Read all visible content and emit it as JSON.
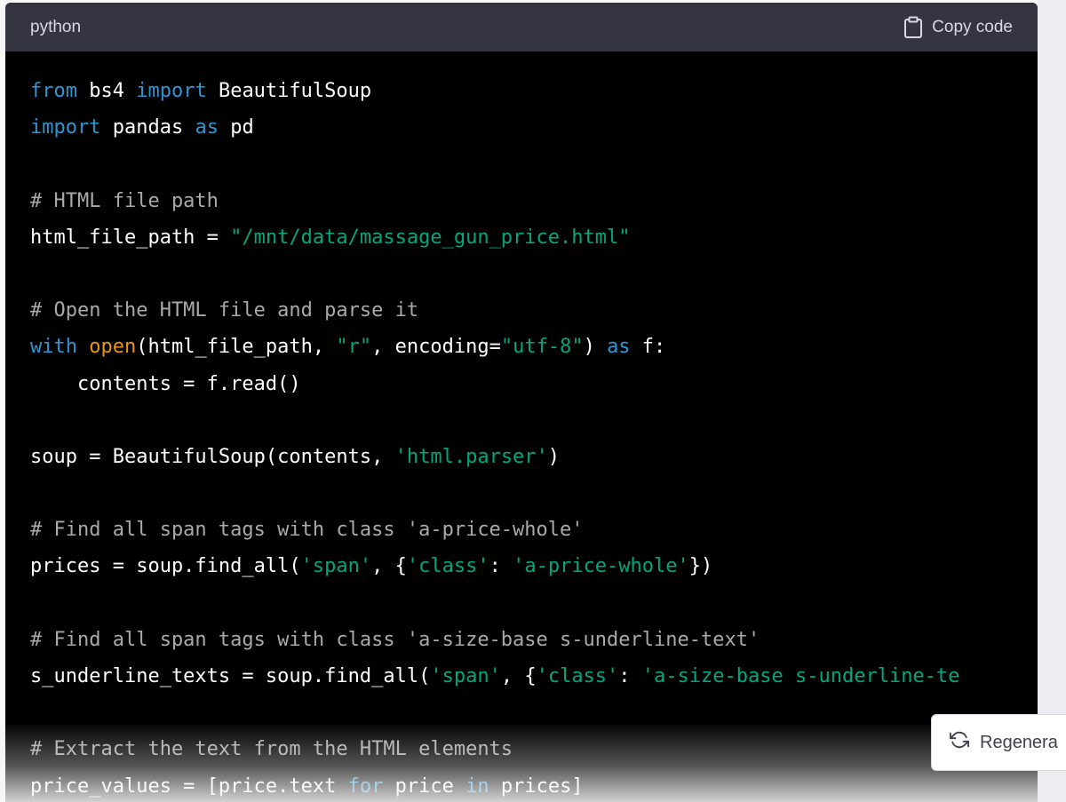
{
  "header": {
    "language": "python",
    "copy_label": "Copy code",
    "copy_icon": "clipboard-icon"
  },
  "code_lines": [
    [
      {
        "t": "kw",
        "v": "from"
      },
      {
        "t": "tx",
        "v": " bs4 "
      },
      {
        "t": "kw",
        "v": "import"
      },
      {
        "t": "tx",
        "v": " BeautifulSoup"
      }
    ],
    [
      {
        "t": "kw",
        "v": "import"
      },
      {
        "t": "tx",
        "v": " pandas "
      },
      {
        "t": "kw",
        "v": "as"
      },
      {
        "t": "tx",
        "v": " pd"
      }
    ],
    [],
    [
      {
        "t": "cm",
        "v": "# HTML file path"
      }
    ],
    [
      {
        "t": "tx",
        "v": "html_file_path = "
      },
      {
        "t": "str",
        "v": "\"/mnt/data/massage_gun_price.html\""
      }
    ],
    [],
    [
      {
        "t": "cm",
        "v": "# Open the HTML file and parse it"
      }
    ],
    [
      {
        "t": "kw",
        "v": "with"
      },
      {
        "t": "tx",
        "v": " "
      },
      {
        "t": "fn",
        "v": "open"
      },
      {
        "t": "tx",
        "v": "(html_file_path, "
      },
      {
        "t": "str",
        "v": "\"r\""
      },
      {
        "t": "tx",
        "v": ", encoding="
      },
      {
        "t": "str",
        "v": "\"utf-8\""
      },
      {
        "t": "tx",
        "v": ") "
      },
      {
        "t": "kw",
        "v": "as"
      },
      {
        "t": "tx",
        "v": " f:"
      }
    ],
    [
      {
        "t": "tx",
        "v": "    contents = f.read()"
      }
    ],
    [],
    [
      {
        "t": "tx",
        "v": "soup = BeautifulSoup(contents, "
      },
      {
        "t": "str",
        "v": "'html.parser'"
      },
      {
        "t": "tx",
        "v": ")"
      }
    ],
    [],
    [
      {
        "t": "cm",
        "v": "# Find all span tags with class 'a-price-whole'"
      }
    ],
    [
      {
        "t": "tx",
        "v": "prices = soup.find_all("
      },
      {
        "t": "str",
        "v": "'span'"
      },
      {
        "t": "tx",
        "v": ", {"
      },
      {
        "t": "str",
        "v": "'class'"
      },
      {
        "t": "tx",
        "v": ": "
      },
      {
        "t": "str",
        "v": "'a-price-whole'"
      },
      {
        "t": "tx",
        "v": "})"
      }
    ],
    [],
    [
      {
        "t": "cm",
        "v": "# Find all span tags with class 'a-size-base s-underline-text'"
      }
    ],
    [
      {
        "t": "tx",
        "v": "s_underline_texts = soup.find_all("
      },
      {
        "t": "str",
        "v": "'span'"
      },
      {
        "t": "tx",
        "v": ", {"
      },
      {
        "t": "str",
        "v": "'class'"
      },
      {
        "t": "tx",
        "v": ": "
      },
      {
        "t": "str",
        "v": "'a-size-base s-underline-te"
      }
    ],
    [],
    [
      {
        "t": "cm",
        "v": "# Extract the text from the HTML elements"
      }
    ],
    [
      {
        "t": "tx",
        "v": "price_values = [price.text "
      },
      {
        "t": "kw",
        "v": "for"
      },
      {
        "t": "tx",
        "v": " price "
      },
      {
        "t": "kw",
        "v": "in"
      },
      {
        "t": "tx",
        "v": " prices]"
      }
    ]
  ],
  "regenerate": {
    "label": "Regenera",
    "icon": "refresh-icon"
  },
  "colors": {
    "keyword": "#2e95d3",
    "function": "#e9950c",
    "string": "#00a67d",
    "comment": "#a9a9a9",
    "text": "#ffffff",
    "header_bg": "#343541",
    "code_bg": "#000000"
  }
}
